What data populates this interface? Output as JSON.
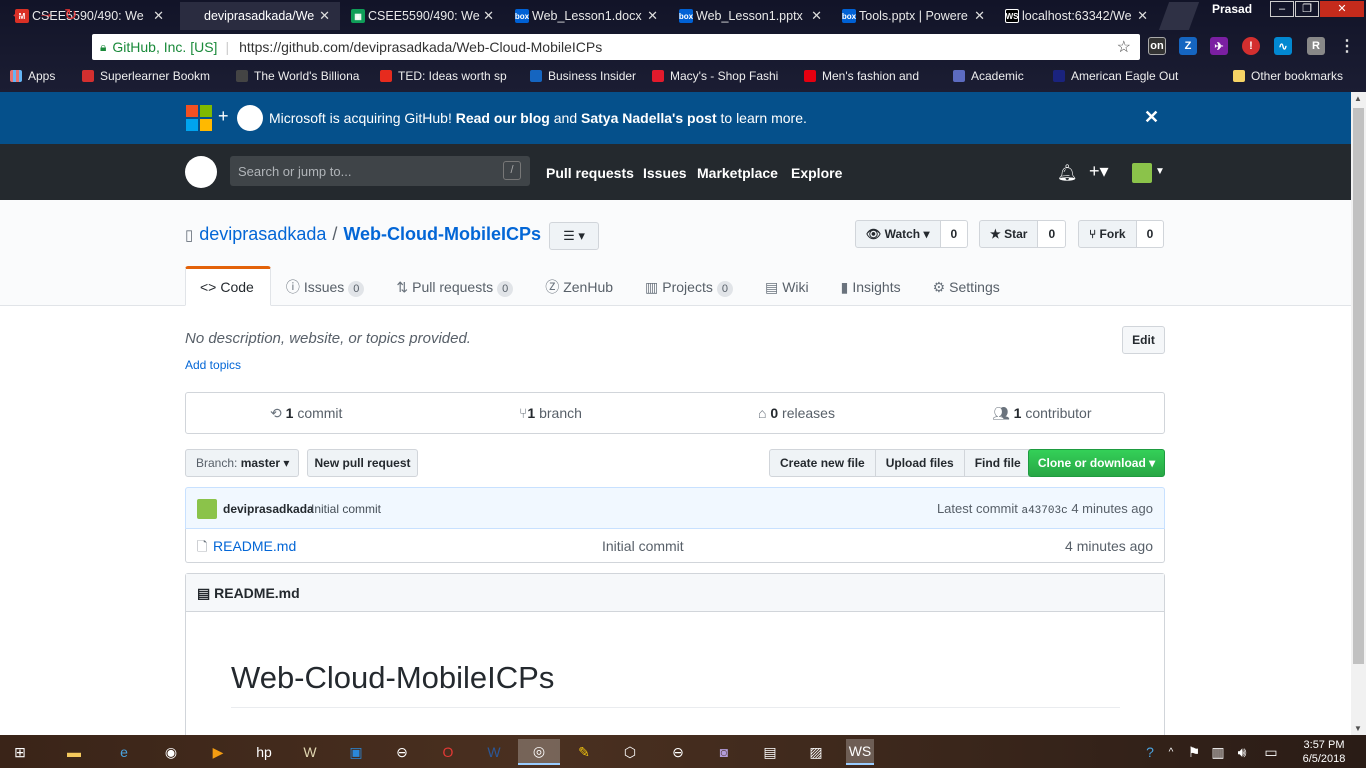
{
  "browser": {
    "tabs": [
      {
        "title": "CSEE5590/490: We",
        "icon": "gmail-icon",
        "color": "#d93025"
      },
      {
        "title": "deviprasadkada/We",
        "icon": "github-icon",
        "color": "#333333"
      },
      {
        "title": "CSEE5590/490: We",
        "icon": "sheets-icon",
        "color": "#0f9d58"
      },
      {
        "title": "Web_Lesson1.docx",
        "icon": "box-icon",
        "color": "#0061d5"
      },
      {
        "title": "Web_Lesson1.pptx",
        "icon": "box-icon",
        "color": "#0061d5"
      },
      {
        "title": "Tools.pptx | Powere",
        "icon": "box-icon",
        "color": "#0061d5"
      },
      {
        "title": "localhost:63342/We",
        "icon": "webstorm-icon",
        "color": "#000000"
      }
    ],
    "profile_name": "Prasad",
    "url_org": "GitHub, Inc. [US]",
    "url": "https://github.com/deviprasadkada/Web-Cloud-MobileICPs",
    "bookmarks": [
      {
        "label": "Apps",
        "icon": "apps-icon",
        "color": "#e57373"
      },
      {
        "label": "Superlearner Bookm",
        "icon": "bookmark-icon",
        "color": "#d32f2f"
      },
      {
        "label": "The World's Billiona",
        "icon": "forbes-icon",
        "color": "#444444"
      },
      {
        "label": "TED: Ideas worth sp",
        "icon": "ted-icon",
        "color": "#e62b1e"
      },
      {
        "label": "Business Insider",
        "icon": "bi-icon",
        "color": "#1565c0"
      },
      {
        "label": "Macy's - Shop Fashi",
        "icon": "macys-star-icon",
        "color": "#e21a2c"
      },
      {
        "label": "Men's fashion and",
        "icon": "hm-icon",
        "color": "#e50010"
      },
      {
        "label": "Academic",
        "icon": "folder-icon",
        "color": "#5c6bc0"
      },
      {
        "label": "American Eagle Out",
        "icon": "eagle-icon",
        "color": "#1a237e"
      },
      {
        "label": "Other bookmarks",
        "icon": "folder-icon",
        "color": "#f6d365"
      }
    ]
  },
  "banner": {
    "msg_pre": "Microsoft is acquiring GitHub!",
    "link1": "Read our blog",
    "and": "and",
    "link2": "Satya Nadella's post",
    "msg_post": "to learn more."
  },
  "header": {
    "search_placeholder": "Search or jump to...",
    "slash": "/",
    "nav": [
      "Pull requests",
      "Issues",
      "Marketplace",
      "Explore"
    ]
  },
  "repo": {
    "owner": "deviprasadkada",
    "sep": "/",
    "name": "Web-Cloud-MobileICPs",
    "watch": {
      "label": "Watch",
      "count": "0"
    },
    "star": {
      "label": "Star",
      "count": "0"
    },
    "fork": {
      "label": "Fork",
      "count": "0"
    },
    "tabs": [
      {
        "label": "Code",
        "icon": "code-icon",
        "count": null
      },
      {
        "label": "Issues",
        "icon": "issue-icon",
        "count": "0"
      },
      {
        "label": "Pull requests",
        "icon": "pull-request-icon",
        "count": "0"
      },
      {
        "label": "ZenHub",
        "icon": "zenhub-icon",
        "count": null
      },
      {
        "label": "Projects",
        "icon": "project-icon",
        "count": "0"
      },
      {
        "label": "Wiki",
        "icon": "book-icon",
        "count": null
      },
      {
        "label": "Insights",
        "icon": "graph-icon",
        "count": null
      },
      {
        "label": "Settings",
        "icon": "gear-icon",
        "count": null
      }
    ],
    "description": "No description, website, or topics provided.",
    "add_topics": "Add topics",
    "edit": "Edit",
    "summary": {
      "commits": {
        "n": "1",
        "label": "commit"
      },
      "branches": {
        "n": "1",
        "label": "branch"
      },
      "releases": {
        "n": "0",
        "label": "releases"
      },
      "contributors": {
        "n": "1",
        "label": "contributor"
      }
    },
    "branch_label": "Branch:",
    "branch": "master",
    "new_pr": "New pull request",
    "file_buttons": [
      "Create new file",
      "Upload files",
      "Find file"
    ],
    "clone": "Clone or download",
    "commit": {
      "author": "deviprasadkada",
      "message": "Initial commit",
      "latest_label": "Latest commit",
      "sha": "a43703c",
      "age": "4 minutes ago"
    },
    "files": [
      {
        "name": "README.md",
        "message": "Initial commit",
        "age": "4 minutes ago"
      }
    ],
    "readme": {
      "title": "README.md",
      "heading": "Web-Cloud-MobileICPs"
    }
  },
  "taskbar": {
    "time": "3:57 PM",
    "date": "6/5/2018"
  }
}
